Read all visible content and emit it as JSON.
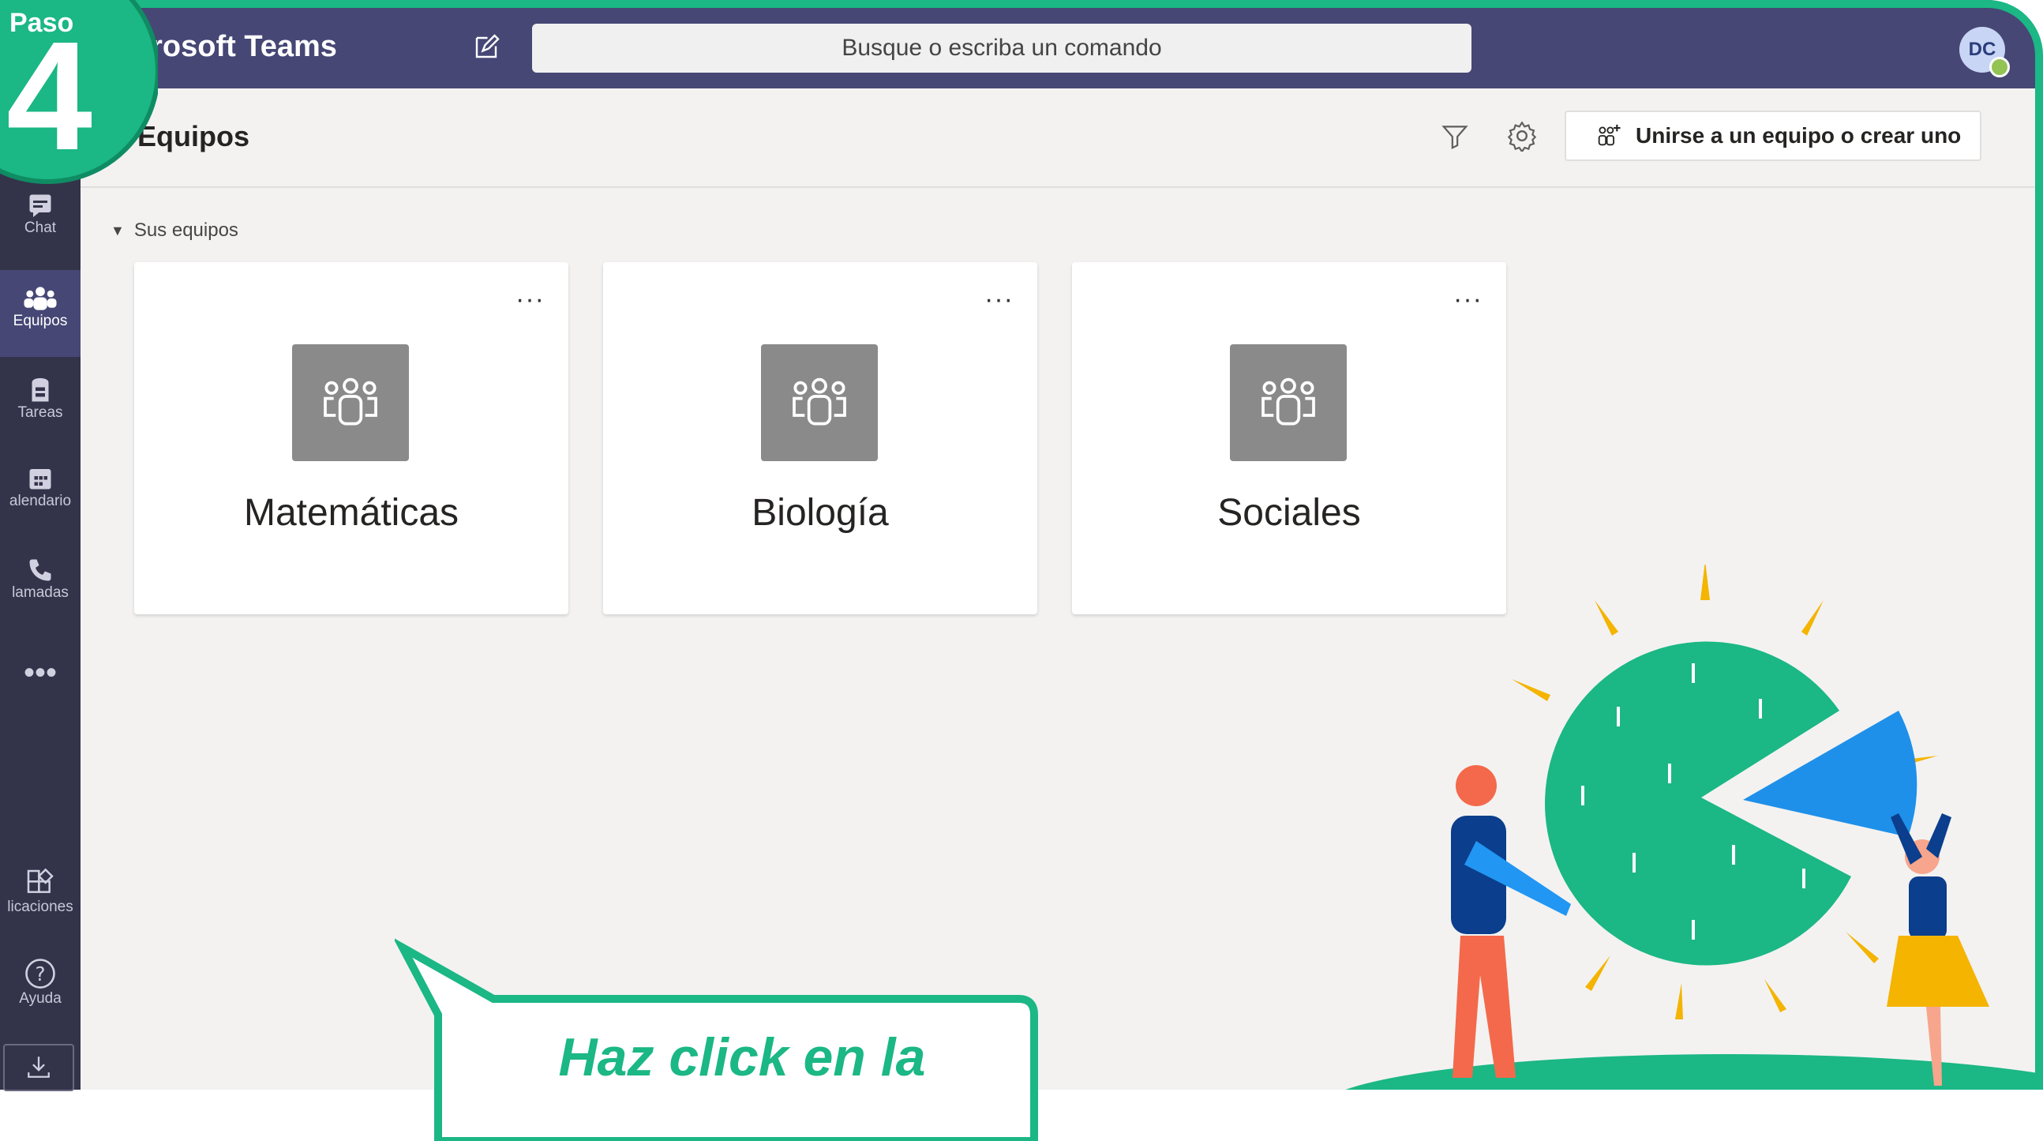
{
  "colors": {
    "accent_green": "#1bb785",
    "titlebar": "#464775",
    "rail": "#33344a",
    "tile_gray": "#8a8a8a"
  },
  "step": {
    "label": "Paso",
    "number": "4"
  },
  "titlebar": {
    "app_name": "crosoft Teams",
    "search_placeholder": "Busque o escriba un comando",
    "avatar_initials": "DC"
  },
  "rail": {
    "items": [
      {
        "label": "Chat",
        "icon": "chat-icon"
      },
      {
        "label": "Equipos",
        "icon": "teams-icon",
        "active": true
      },
      {
        "label": "Tareas",
        "icon": "assignments-icon"
      },
      {
        "label": "alendario",
        "icon": "calendar-icon"
      },
      {
        "label": "lamadas",
        "icon": "phone-icon"
      },
      {
        "label": "",
        "icon": "more-apps-icon"
      },
      {
        "label": "licaciones",
        "icon": "apps-icon"
      },
      {
        "label": "Ayuda",
        "icon": "help-icon"
      },
      {
        "label": "",
        "icon": "download-icon"
      }
    ]
  },
  "header": {
    "title": "Equipos",
    "join_button": "Unirse a un equipo o crear uno"
  },
  "section": {
    "label": "Sus equipos"
  },
  "teams": [
    {
      "name": "Matemáticas",
      "more": "···"
    },
    {
      "name": "Biología",
      "more": "···"
    },
    {
      "name": "Sociales",
      "more": "···"
    }
  ],
  "callout": {
    "text": "Haz click en la"
  }
}
